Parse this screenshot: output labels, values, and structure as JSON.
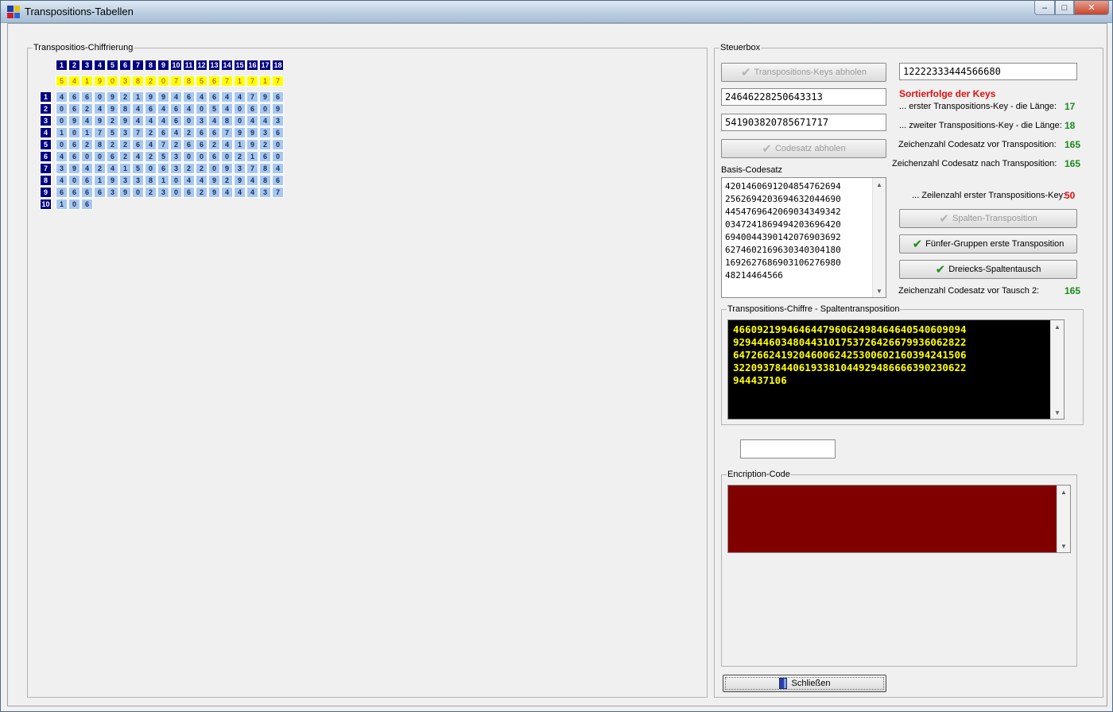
{
  "window": {
    "title": "Transpositions-Tabellen"
  },
  "left_group": {
    "legend": "Transpositios-Chiffrierung",
    "column_headers": [
      "1",
      "2",
      "3",
      "4",
      "5",
      "6",
      "7",
      "8",
      "9",
      "10",
      "11",
      "12",
      "13",
      "14",
      "15",
      "16",
      "17",
      "18"
    ],
    "key_row": [
      "5",
      "4",
      "1",
      "9",
      "0",
      "3",
      "8",
      "2",
      "0",
      "7",
      "8",
      "5",
      "6",
      "7",
      "1",
      "7",
      "1",
      "7"
    ],
    "row_headers": [
      "1",
      "2",
      "3",
      "4",
      "5",
      "6",
      "7",
      "8",
      "9",
      "10"
    ],
    "rows": [
      [
        "4",
        "6",
        "6",
        "0",
        "9",
        "2",
        "1",
        "9",
        "9",
        "4",
        "6",
        "4",
        "6",
        "4",
        "4",
        "7",
        "9",
        "6"
      ],
      [
        "0",
        "6",
        "2",
        "4",
        "9",
        "8",
        "4",
        "6",
        "4",
        "6",
        "4",
        "0",
        "5",
        "4",
        "0",
        "6",
        "0",
        "9"
      ],
      [
        "0",
        "9",
        "4",
        "9",
        "2",
        "9",
        "4",
        "4",
        "4",
        "6",
        "0",
        "3",
        "4",
        "8",
        "0",
        "4",
        "4",
        "3"
      ],
      [
        "1",
        "0",
        "1",
        "7",
        "5",
        "3",
        "7",
        "2",
        "6",
        "4",
        "2",
        "6",
        "6",
        "7",
        "9",
        "9",
        "3",
        "6"
      ],
      [
        "0",
        "6",
        "2",
        "8",
        "2",
        "2",
        "6",
        "4",
        "7",
        "2",
        "6",
        "6",
        "2",
        "4",
        "1",
        "9",
        "2",
        "0"
      ],
      [
        "4",
        "6",
        "0",
        "0",
        "6",
        "2",
        "4",
        "2",
        "5",
        "3",
        "0",
        "0",
        "6",
        "0",
        "2",
        "1",
        "6",
        "0"
      ],
      [
        "3",
        "9",
        "4",
        "2",
        "4",
        "1",
        "5",
        "0",
        "6",
        "3",
        "2",
        "2",
        "0",
        "9",
        "3",
        "7",
        "8",
        "4"
      ],
      [
        "4",
        "0",
        "6",
        "1",
        "9",
        "3",
        "3",
        "8",
        "1",
        "0",
        "4",
        "4",
        "9",
        "2",
        "9",
        "4",
        "8",
        "6"
      ],
      [
        "6",
        "6",
        "6",
        "6",
        "3",
        "9",
        "0",
        "2",
        "3",
        "0",
        "6",
        "2",
        "9",
        "4",
        "4",
        "4",
        "3",
        "7"
      ],
      [
        "1",
        "0",
        "6"
      ]
    ]
  },
  "steuerbox": {
    "legend": "Steuerbox",
    "btn_keys_abholen": "Transpositions-Keys abholen",
    "key1_value": "24646228250643313",
    "key2_value": "541903820785671717",
    "btn_codesatz_abholen": "Codesatz abholen",
    "basis_label": "Basis-Codesatz",
    "basis_lines": [
      "420146069120485476269 4",
      "256269420369463204469 0",
      "445476964206903434934 2",
      "034724186949420369642 0",
      "694004439014207690369 2",
      "627460216963034030418 0",
      "169262768690310627698 0",
      "48214464566"
    ],
    "sort_value": "12222333444566680",
    "sort_title": "Sortierfolge der Keys",
    "len1_label": "... erster Transpositions-Key - die Länge:",
    "len1_value": "17",
    "len2_label": "... zweiter Transpositions-Key - die Länge:",
    "len2_value": "18",
    "count_before_label": "Zeichenzahl Codesatz vor Transposition:",
    "count_before_value": "165",
    "count_after_label": "Zeichenzahl Codesatz nach Transposition:",
    "count_after_value": "165",
    "rows_label": "... Zeilenzahl erster Transpositions-Key:",
    "rows_value": "50",
    "btn_spalten": "Spalten-Transposition",
    "btn_fuenfer": "Fünfer-Gruppen erste Transposition",
    "btn_dreiecks": "Dreiecks-Spaltentausch",
    "tausch_label": "Zeichenzahl Codesatz vor Tausch 2:",
    "tausch_value": "165",
    "cipher_legend": "Transpositions-Chiffre - Spaltentransposition",
    "cipher_lines": [
      "466092199464644796062498464640540609094",
      "929444603480443101753726426679936062822",
      "647266241920460062425300602160394241506",
      "322093784406193381044929486666390230622",
      "944437106"
    ],
    "small_input_value": "",
    "encryption_legend": "Encription-Code",
    "encryption_text": "",
    "btn_close": "Schließen"
  },
  "colors": {
    "header_blue": "#000080",
    "key_yellow": "#ffff00",
    "cell_blue": "#a6c8f0",
    "cipher_bg": "#000000",
    "cipher_fg": "#ffff00",
    "encryption_bg": "#800000",
    "value_green": "#1a8a1a",
    "value_red": "#e01010"
  }
}
